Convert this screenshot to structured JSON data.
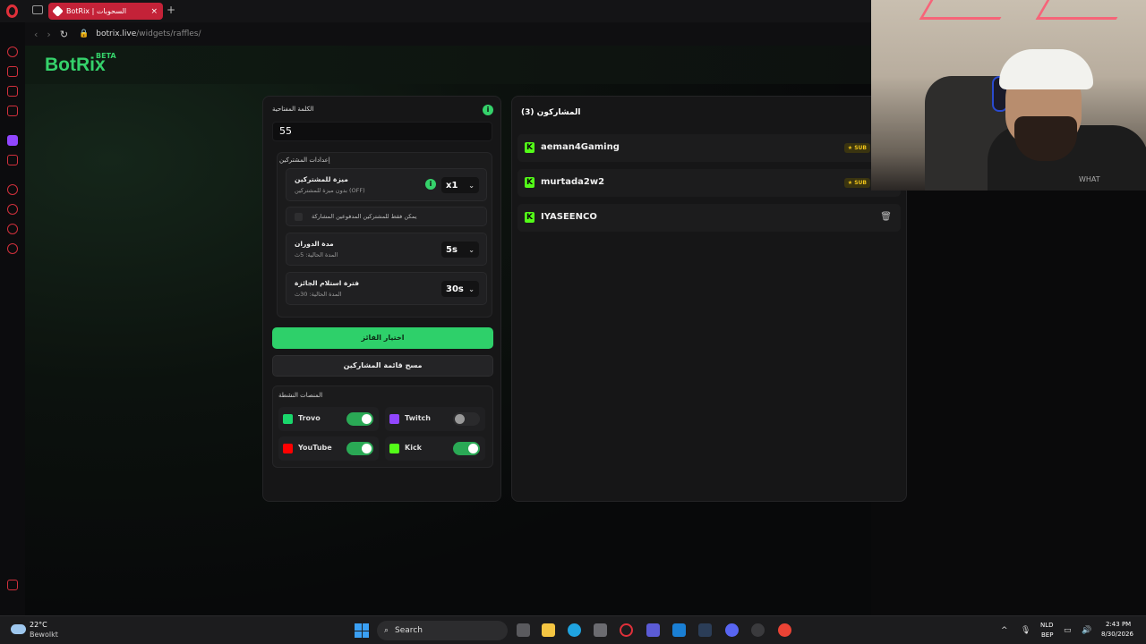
{
  "browser": {
    "tab_title": "BotRix | السحوبات",
    "tab_close": "×",
    "new_tab": "+",
    "url_host": "botrix.live",
    "url_path": "/widgets/raffles/"
  },
  "app": {
    "brand": "BotRix",
    "beta": "BETA"
  },
  "left_panel": {
    "keyword_label": "الكلمة المفتاحية",
    "keyword_value": "55",
    "settings_title": "إعدادات المشتركين",
    "subscriber_bonus": {
      "title": "ميزة للمشتركين",
      "subtitle": "بدون ميزة للمشتركين (OFF)",
      "value": "x1"
    },
    "paid_only_label": "يمكن فقط للمشتركين المدفوعين المشاركة",
    "spin_duration": {
      "title": "مدة الدوران",
      "subtitle": "المدة الحالية: 5ث",
      "value": "5s"
    },
    "claim_period": {
      "title": "فترة استلام الجائزة",
      "subtitle": "المدة الحالية: 30ث",
      "value": "30s"
    },
    "pick_winner": "اختيار الفائز",
    "clear_list": "مسح قائمة المشاركين",
    "platforms_title": "المنصات النشطة",
    "platforms": [
      {
        "name": "Trovo",
        "enabled": true,
        "color": "#19d66b"
      },
      {
        "name": "Twitch",
        "enabled": false,
        "color": "#9146ff"
      },
      {
        "name": "YouTube",
        "enabled": true,
        "color": "#ff0000"
      },
      {
        "name": "Kick",
        "enabled": true,
        "color": "#53fc18"
      }
    ]
  },
  "right_panel": {
    "header": "المشاركون (3)",
    "participants": [
      {
        "name": "aeman4Gaming",
        "badge": "SUB"
      },
      {
        "name": "murtada2w2",
        "badge": "SUB"
      },
      {
        "name": "IYASEENCO",
        "badge": ""
      }
    ],
    "sub_badge_label": "★ SUB"
  },
  "taskbar": {
    "weather_temp": "22°C",
    "weather_desc": "Bewolkt",
    "search": "Search",
    "lang_top": "NLD",
    "lang_bottom": "BEP",
    "time": "2:43 PM",
    "date": "8/30/2026"
  },
  "webcam": {
    "shirt_text": "WHAT"
  },
  "colors": {
    "accent": "#35d26b",
    "tab_active": "#c42238",
    "sub_badge": "#f0c419"
  }
}
